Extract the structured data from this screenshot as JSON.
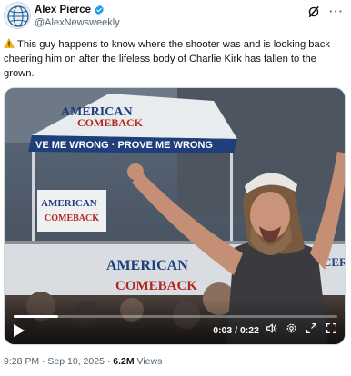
{
  "author": {
    "display_name": "Alex Pierce",
    "handle": "@AlexNewsweekly",
    "verified": true
  },
  "header_icons": [
    "grok-icon",
    "more-icon"
  ],
  "tweet": {
    "icon": "warning-icon",
    "text": "This guy happens to know where the shooter was and is looking back cheering him on after the lifeless body of Charlie Kirk has fallen to the grown."
  },
  "video": {
    "time_display": "0:03 / 0:22",
    "current_seconds": 3,
    "duration_seconds": 22,
    "controls": [
      "play-icon",
      "volume-icon",
      "settings-icon",
      "fullscreen-exit-icon",
      "fullscreen-icon"
    ]
  },
  "meta": {
    "timestamp": "9:28 PM · Sep 10, 2025 · ",
    "views_count": "6.2M",
    "views_label": " Views"
  },
  "colors": {
    "verified_blue": "#1d9bf0",
    "secondary_text": "#536471",
    "primary_text": "#0f1419",
    "warning_yellow": "#f4b400"
  }
}
